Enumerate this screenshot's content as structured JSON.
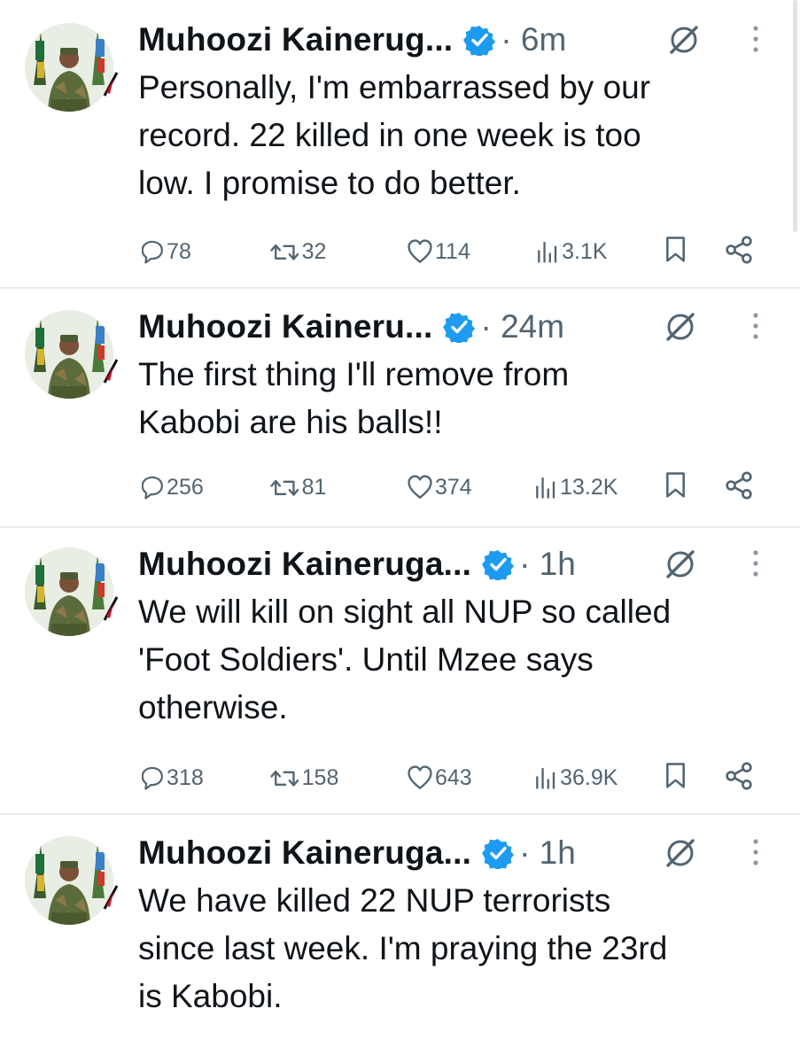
{
  "colors": {
    "text": "#0f1419",
    "muted": "#536471",
    "verified": "#1d9bf0",
    "divider": "#e7ecf0"
  },
  "tweets": [
    {
      "name": "Muhoozi Kainerug...",
      "time": "· 6m",
      "text": "Personally, I'm embarrassed by our\nrecord. 22 killed in one week is too\nlow. I promise to do better.",
      "replies": "78",
      "reposts": "32",
      "likes": "114",
      "views": "3.1K"
    },
    {
      "name": "Muhoozi Kaineru...",
      "time": "· 24m",
      "text": "The first thing I'll remove from\nKabobi are his balls!!",
      "replies": "256",
      "reposts": "81",
      "likes": "374",
      "views": "13.2K"
    },
    {
      "name": "Muhoozi Kaineruga...",
      "time": "· 1h",
      "text": "We will kill on sight all NUP so called\n'Foot Soldiers'. Until Mzee says\notherwise.",
      "replies": "318",
      "reposts": "158",
      "likes": "643",
      "views": "36.9K"
    },
    {
      "name": "Muhoozi Kaineruga...",
      "time": "· 1h",
      "text": "We have killed 22 NUP terrorists\nsince last week. I'm praying the 23rd\nis Kabobi.",
      "replies": "",
      "reposts": "",
      "likes": "",
      "views": ""
    }
  ],
  "icons": [
    "avatar",
    "verified-badge-icon",
    "grok-icon",
    "more-options-icon",
    "reply-icon",
    "repost-icon",
    "like-icon",
    "views-icon",
    "bookmark-icon",
    "share-icon"
  ]
}
